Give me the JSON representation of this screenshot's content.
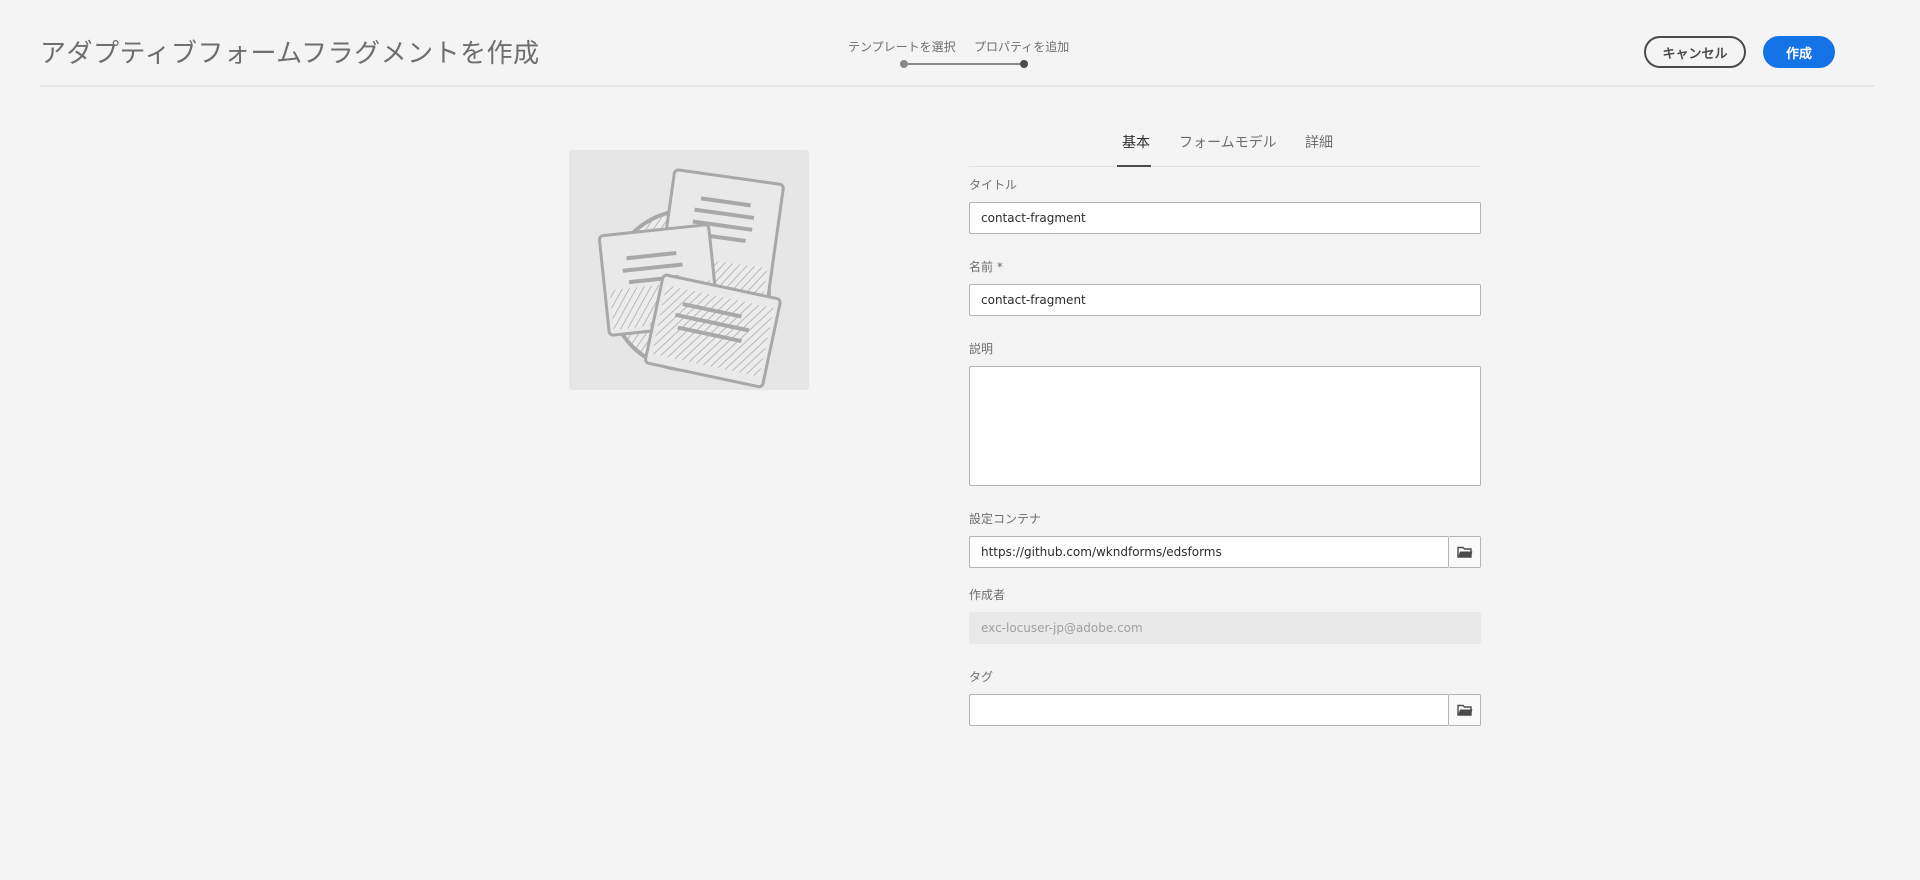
{
  "header": {
    "title": "アダプティブフォームフラグメントを作成",
    "steps": [
      "テンプレートを選択",
      "プロパティを追加"
    ],
    "cancel_label": "キャンセル",
    "create_label": "作成"
  },
  "tabs": [
    "基本",
    "フォームモデル",
    "詳細"
  ],
  "form": {
    "title_label": "タイトル",
    "title_value": "contact-fragment",
    "name_label": "名前 *",
    "name_value": "contact-fragment",
    "description_label": "説明",
    "description_value": "",
    "config_label": "設定コンテナ",
    "config_value": "https://github.com/wkndforms/edsforms",
    "author_label": "作成者",
    "author_value": "exc-locuser-jp@adobe.com",
    "tags_label": "タグ",
    "tags_value": ""
  },
  "icons": {
    "thumbnail": "fragment-documents-icon",
    "browse": "folder-icon"
  },
  "colors": {
    "primary": "#1473e6",
    "background": "#f4f4f4"
  }
}
